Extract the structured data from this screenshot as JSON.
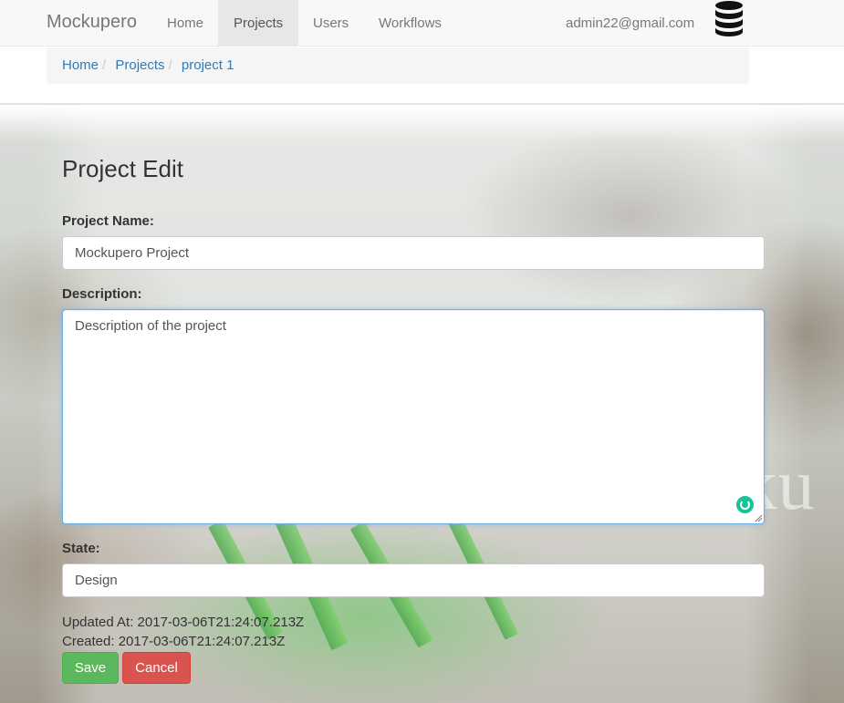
{
  "navbar": {
    "brand": "Mockupero",
    "items": [
      {
        "label": "Home"
      },
      {
        "label": "Projects",
        "active": true
      },
      {
        "label": "Users"
      },
      {
        "label": "Workflows"
      }
    ],
    "user_email": "admin22@gmail.com",
    "user_icon": "database-icon"
  },
  "breadcrumb": {
    "items": [
      "Home",
      "Projects",
      "project 1"
    ],
    "separator": "/"
  },
  "page": {
    "title": "Project Edit",
    "background_watermark": "Mocku"
  },
  "form": {
    "name_label": "Project Name:",
    "name_value": "Mockupero Project",
    "description_label": "Description:",
    "description_value": "Description of the project",
    "state_label": "State:",
    "state_value": "Design",
    "updated_at": "Updated At: 2017-03-06T21:24:07.213Z",
    "created": "Created: 2017-03-06T21:24:07.213Z",
    "save_label": "Save",
    "cancel_label": "Cancel"
  },
  "colors": {
    "link": "#337ab7",
    "save": "#5cb85c",
    "cancel": "#d9534f",
    "focus": "#66afe9"
  }
}
